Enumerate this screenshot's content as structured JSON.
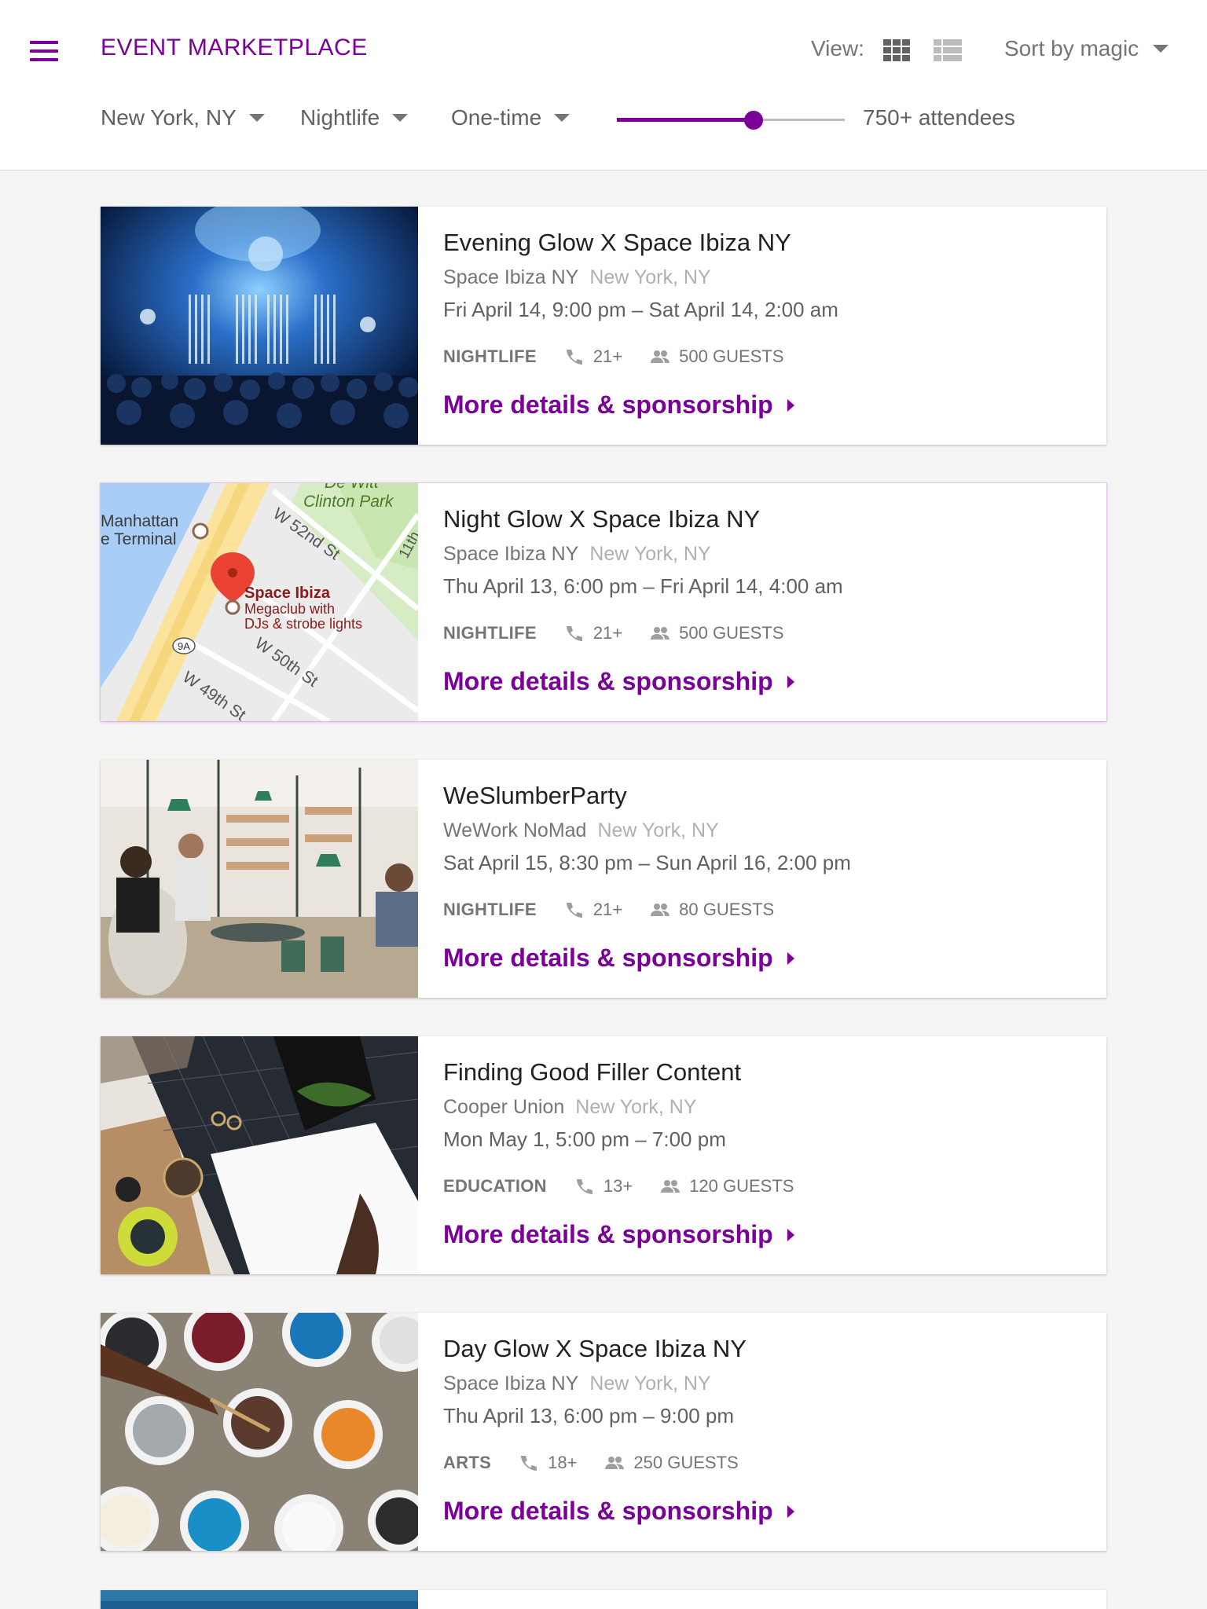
{
  "header": {
    "title": "EVENT MARKETPLACE",
    "view_label": "View:",
    "sort_label": "Sort by magic",
    "icons": [
      "menu-icon",
      "grid-view-icon",
      "list-view-icon",
      "chevron-down-icon"
    ]
  },
  "filters": {
    "location": "New York, NY",
    "category": "Nightlife",
    "frequency": "One-time",
    "attendees_label": "750+ attendees",
    "attendees_slider_fraction": 0.6
  },
  "colors": {
    "accent": "#7b0099",
    "text_primary": "#212121",
    "text_secondary": "#757575",
    "text_muted": "#b0b0b0",
    "background": "#f5f5f5"
  },
  "events": [
    {
      "title": "Evening Glow X Space Ibiza NY",
      "venue": "Space Ibiza NY",
      "city": "New York, NY",
      "dates": "Fri April 14, 9:00 pm – Sat April 14, 2:00 am",
      "category": "NIGHTLIFE",
      "age": "21+",
      "guests": "500 GUESTS",
      "cta": "More details & sponsorship",
      "image": "concert-photo"
    },
    {
      "title": "Night Glow X Space Ibiza NY",
      "venue": "Space Ibiza NY",
      "city": "New York, NY",
      "dates": "Thu April 13, 6:00 pm – Fri April 14, 4:00 am",
      "category": "NIGHTLIFE",
      "age": "21+",
      "guests": "500 GUESTS",
      "cta": "More details & sponsorship",
      "image": "map",
      "map": {
        "park": "De Witt",
        "park2": "Clinton Park",
        "terminal_line1": "Manhattan",
        "terminal_line2": "e Terminal",
        "street_52": "W 52nd St",
        "street_50": "W 50th St",
        "street_49": "W 49th St",
        "street_11": "11th",
        "highway": "9A",
        "pin_title": "Space Ibiza",
        "pin_line1": "Megaclub with",
        "pin_line2": "DJs & strobe lights"
      }
    },
    {
      "title": "WeSlumberParty",
      "venue": "WeWork NoMad",
      "city": "New York, NY",
      "dates": "Sat April 15, 8:30 pm – Sun April 16, 2:00 pm",
      "category": "NIGHTLIFE",
      "age": "21+",
      "guests": "80 GUESTS",
      "cta": "More details & sponsorship",
      "image": "cafe-photo"
    },
    {
      "title": "Finding Good Filler Content",
      "venue": "Cooper Union",
      "city": "New York, NY",
      "dates": "Mon May 1, 5:00 pm – 7:00 pm",
      "category": "EDUCATION",
      "age": "13+",
      "guests": "120 GUESTS",
      "cta": "More details & sponsorship",
      "image": "desk-photo"
    },
    {
      "title": "Day Glow X Space Ibiza NY",
      "venue": "Space Ibiza NY",
      "city": "New York, NY",
      "dates": "Thu April 13, 6:00 pm – 9:00 pm",
      "category": "ARTS",
      "age": "18+",
      "guests": "250 GUESTS",
      "cta": "More details & sponsorship",
      "image": "paint-photo"
    }
  ]
}
